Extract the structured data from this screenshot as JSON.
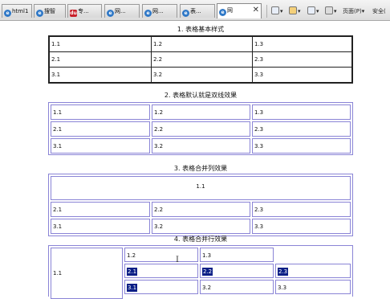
{
  "browser": {
    "tabs": [
      {
        "label": "html1",
        "icon": "ie-page-icon"
      },
      {
        "label": "搜智",
        "icon": "ie-page-icon"
      },
      {
        "label": "专...",
        "icon": "baidu-icon"
      },
      {
        "label": "网...",
        "icon": "ie-page-icon"
      },
      {
        "label": "网...",
        "icon": "ie-page-icon"
      },
      {
        "label": "表...",
        "icon": "ie-page-icon"
      },
      {
        "label": "网",
        "icon": "ie-page-icon",
        "active": true
      }
    ],
    "close_glyph": "✕",
    "toolbar": {
      "home_label": "",
      "feeds_label": "",
      "print_label": "",
      "page_label": "页面(P)",
      "safety_label": "安全("
    }
  },
  "sections": [
    {
      "heading": "1.  表格基本样式",
      "rows": [
        [
          "1.1",
          "1.2",
          "1.3"
        ],
        [
          "2.1",
          "2.2",
          "2.3"
        ],
        [
          "3.1",
          "3.2",
          "3.3"
        ]
      ]
    },
    {
      "heading": "2.  表格默认就是双线效果",
      "rows": [
        [
          "1.1",
          "1.2",
          "1.3"
        ],
        [
          "2.1",
          "2.2",
          "2.3"
        ],
        [
          "3.1",
          "3.2",
          "3.3"
        ]
      ]
    },
    {
      "heading": "3.  表格合并列效果",
      "merged": "1.1",
      "rows": [
        [
          "2.1",
          "2.2",
          "2.3"
        ],
        [
          "3.1",
          "3.2",
          "3.3"
        ]
      ]
    },
    {
      "heading": "4.  表格合并行效果",
      "merged": "1.1",
      "row1": [
        "1.2",
        "1.3"
      ],
      "row2": [
        "2.1",
        "2.2",
        "2.3"
      ],
      "row3": [
        "3.1",
        "3.2",
        "3.3"
      ],
      "selected": [
        "2.1",
        "2.2",
        "2.3",
        "3.1"
      ]
    }
  ],
  "colors": {
    "double_border": "#8a84d6",
    "selection": "#0a1f86",
    "solid_border": "#222222"
  }
}
